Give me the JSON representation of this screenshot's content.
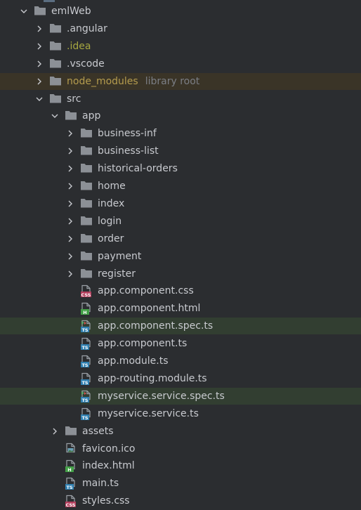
{
  "root": {
    "name": "emlWeb"
  },
  "items": [
    {
      "label": "emlWeb",
      "type": "folder",
      "depth": 0,
      "expanded": true
    },
    {
      "label": ".angular",
      "type": "folder",
      "depth": 1,
      "expanded": false
    },
    {
      "label": ".idea",
      "type": "folder",
      "depth": 1,
      "expanded": false,
      "style": "excluded"
    },
    {
      "label": ".vscode",
      "type": "folder",
      "depth": 1,
      "expanded": false
    },
    {
      "label": "node_modules",
      "type": "folder",
      "depth": 1,
      "expanded": false,
      "style": "module",
      "hint": "library root"
    },
    {
      "label": "src",
      "type": "folder",
      "depth": 1,
      "expanded": true
    },
    {
      "label": "app",
      "type": "folder",
      "depth": 2,
      "expanded": true
    },
    {
      "label": "business-inf",
      "type": "folder",
      "depth": 3,
      "expanded": false
    },
    {
      "label": "business-list",
      "type": "folder",
      "depth": 3,
      "expanded": false
    },
    {
      "label": "historical-orders",
      "type": "folder",
      "depth": 3,
      "expanded": false
    },
    {
      "label": "home",
      "type": "folder",
      "depth": 3,
      "expanded": false
    },
    {
      "label": "index",
      "type": "folder",
      "depth": 3,
      "expanded": false
    },
    {
      "label": "login",
      "type": "folder",
      "depth": 3,
      "expanded": false
    },
    {
      "label": "order",
      "type": "folder",
      "depth": 3,
      "expanded": false
    },
    {
      "label": "payment",
      "type": "folder",
      "depth": 3,
      "expanded": false
    },
    {
      "label": "register",
      "type": "folder",
      "depth": 3,
      "expanded": false
    },
    {
      "label": "app.component.css",
      "type": "css",
      "depth": 3
    },
    {
      "label": "app.component.html",
      "type": "html",
      "depth": 3
    },
    {
      "label": "app.component.spec.ts",
      "type": "spec",
      "depth": 3,
      "highlighted": true
    },
    {
      "label": "app.component.ts",
      "type": "ts",
      "depth": 3
    },
    {
      "label": "app.module.ts",
      "type": "ts",
      "depth": 3
    },
    {
      "label": "app-routing.module.ts",
      "type": "ts",
      "depth": 3
    },
    {
      "label": "myservice.service.spec.ts",
      "type": "spec",
      "depth": 3,
      "highlighted": true
    },
    {
      "label": "myservice.service.ts",
      "type": "ts",
      "depth": 3
    },
    {
      "label": "assets",
      "type": "folder",
      "depth": 2,
      "expanded": false
    },
    {
      "label": "favicon.ico",
      "type": "ico",
      "depth": 2
    },
    {
      "label": "index.html",
      "type": "html",
      "depth": 2
    },
    {
      "label": "main.ts",
      "type": "ts",
      "depth": 2
    },
    {
      "label": "styles.css",
      "type": "css",
      "depth": 2
    }
  ],
  "badges": {
    "css": "CSS",
    "html": "H",
    "ts": "TS",
    "spec": "TS"
  },
  "colors": {
    "background": "#2b2d30",
    "text": "#c8cacf",
    "folder": "#8c9096",
    "excluded_text": "#a6a640",
    "module_text": "#b59c4e",
    "hint_text": "#7b7e85",
    "highlight_row": "#323e31",
    "library_row": "#3a3427",
    "css_badge": "#b33d5c",
    "html_badge": "#43a047",
    "ts_badge": "#2f7fb0"
  },
  "icons": {
    "folder": "folder-icon",
    "css": "css-file-icon",
    "html": "html-file-icon",
    "ts": "typescript-file-icon",
    "spec": "test-file-icon",
    "ico": "image-file-icon",
    "expanded": "chevron-down-icon",
    "collapsed": "chevron-right-icon"
  }
}
